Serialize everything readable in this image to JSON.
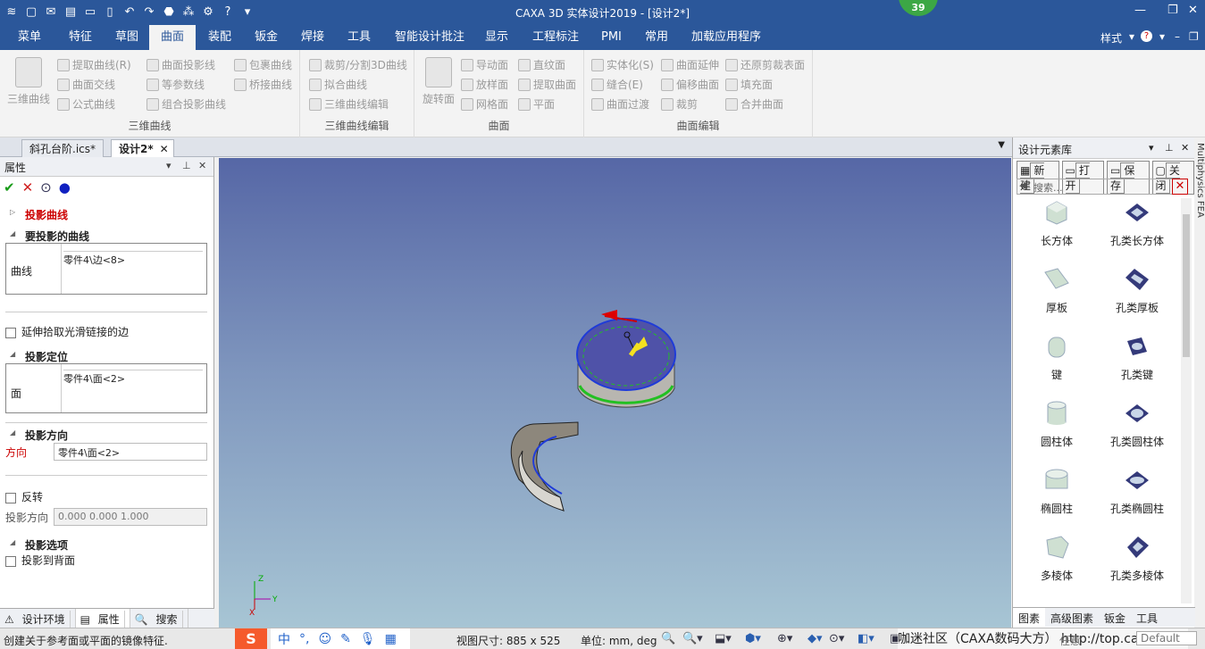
{
  "window": {
    "title": "CAXA 3D 实体设计2019 - [设计2*]",
    "notification_count": "39"
  },
  "quick_access": [
    "≋",
    "▢",
    "✉",
    "▤",
    "▭",
    "▯",
    "↶",
    "↷",
    "⬣",
    "⁂",
    "⚙",
    "?",
    "▾"
  ],
  "menu": {
    "tabs": [
      "菜单",
      "特征",
      "草图",
      "曲面",
      "装配",
      "钣金",
      "焊接",
      "工具",
      "智能设计批注",
      "显示",
      "工程标注",
      "PMI",
      "常用",
      "加载应用程序"
    ],
    "active": "曲面",
    "style_label": "样式"
  },
  "ribbon": {
    "groups": [
      {
        "name": "三维曲线",
        "big": "三维曲线",
        "items": [
          "提取曲线(R)",
          "曲面投影线",
          "包裹曲线",
          "曲面交线",
          "等参数线",
          "桥接曲线",
          "公式曲线",
          "组合投影曲线"
        ]
      },
      {
        "name": "三维曲线编辑",
        "items": [
          "裁剪/分割3D曲线",
          "拟合曲线",
          "三维曲线编辑"
        ]
      },
      {
        "name": "曲面",
        "big": "旋转面",
        "items": [
          "导动面",
          "直纹面",
          "放样面",
          "提取曲面",
          "网格面",
          "平面"
        ]
      },
      {
        "name": "曲面编辑",
        "items": [
          "实体化(S)",
          "曲面延伸",
          "还原剪裁表面",
          "缝合(E)",
          "偏移曲面",
          "填充面",
          "曲面过渡",
          "裁剪",
          "合并曲面"
        ]
      }
    ]
  },
  "doc_tabs": [
    "斜孔台阶.ics*",
    "设计2*"
  ],
  "properties": {
    "title": "属性",
    "section_projection": "投影曲线",
    "section_curves": "要投影的曲线",
    "curve_label": "曲线",
    "curve_value": "零件4\\边<8>",
    "extend_label": "延伸拾取光滑链接的边",
    "section_position": "投影定位",
    "face_label": "面",
    "face_value": "零件4\\面<2>",
    "section_direction": "投影方向",
    "direction_label": "方向",
    "direction_value": "零件4\\面<2>",
    "reverse_label": "反转",
    "proj_dir_label": "投影方向",
    "proj_dir_value": "0.000  0.000  1.000",
    "section_options": "投影选项",
    "backface_label": "投影到背面"
  },
  "left_bottom_tabs": [
    "设计环境",
    "属性",
    "搜索"
  ],
  "design_library": {
    "title": "设计元素库",
    "buttons": [
      "新建",
      "打开",
      "保存",
      "关闭"
    ],
    "search_placeholder": "搜索...",
    "items": [
      [
        "长方体",
        "孔类长方体"
      ],
      [
        "厚板",
        "孔类厚板"
      ],
      [
        "键",
        "孔类键"
      ],
      [
        "圆柱体",
        "孔类圆柱体"
      ],
      [
        "椭圆柱",
        "孔类椭圆柱"
      ],
      [
        "多棱体",
        "孔类多棱体"
      ]
    ],
    "bottom_tabs": [
      "图素",
      "高级图素",
      "钣金",
      "工具"
    ],
    "side_text": "Multiphysics FEA"
  },
  "status": {
    "message": "创建关于参考面或平面的镜像特征.",
    "view_size": "视图尺寸: 885 x 525",
    "units": "单位: mm, deg",
    "watermark": "咖迷社区（CAXA数码大方） http://top.caxa.com/",
    "select_mode": "任意",
    "render": "Default"
  },
  "ime": [
    "中",
    "°,",
    "☺",
    "✎",
    "🎙",
    "▦"
  ],
  "colors": {
    "accent": "#2b579a",
    "viewport_top": "#5667a6",
    "viewport_bottom": "#a7c5d4",
    "required": "#cc0000"
  }
}
